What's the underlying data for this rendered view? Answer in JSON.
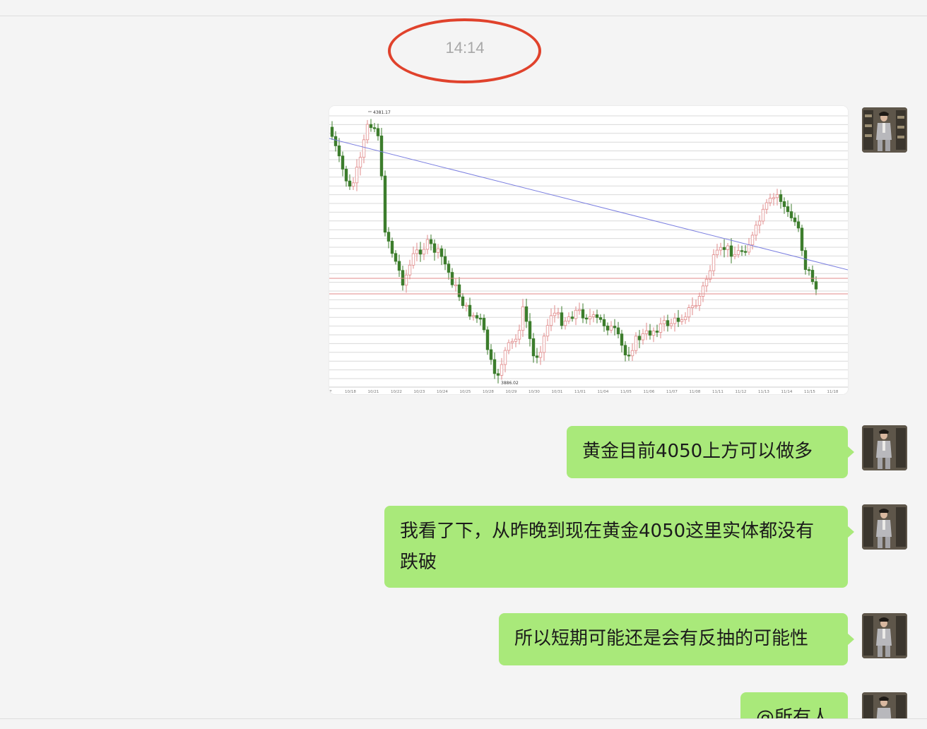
{
  "chat": {
    "timestamp": "14:14",
    "messages": [
      {
        "type": "image",
        "kind": "candlestick-chart"
      },
      {
        "type": "text",
        "text": "黄金目前4050上方可以做多"
      },
      {
        "type": "text",
        "text": "我看了下，从昨晚到现在黄金4050这里实体都没有跌破"
      },
      {
        "type": "text",
        "text": "所以短期可能还是会有反抽的可能性"
      },
      {
        "type": "text",
        "text": "@所有人"
      }
    ]
  },
  "chart_image": {
    "high_label": "4381.17",
    "low_label": "3886.02",
    "date_ticks": [
      "7",
      "10/18",
      "10/21",
      "10/22",
      "10/23",
      "10/24",
      "10/25",
      "10/28",
      "10/29",
      "10/30",
      "10/31",
      "11/01",
      "11/04",
      "11/05",
      "11/06",
      "11/07",
      "11/08",
      "11/11",
      "11/12",
      "11/13",
      "11/14",
      "11/15",
      "11/18"
    ],
    "colors": {
      "bull": "#e08a8a",
      "bear": "#3c7d2c",
      "trendline": "#7b7fe0",
      "support": "#e08a8a",
      "grid": "#d9d9d9"
    }
  },
  "colors": {
    "bubble": "#a9e97a",
    "background": "#f4f4f4",
    "highlight_circle": "#e0422c"
  }
}
